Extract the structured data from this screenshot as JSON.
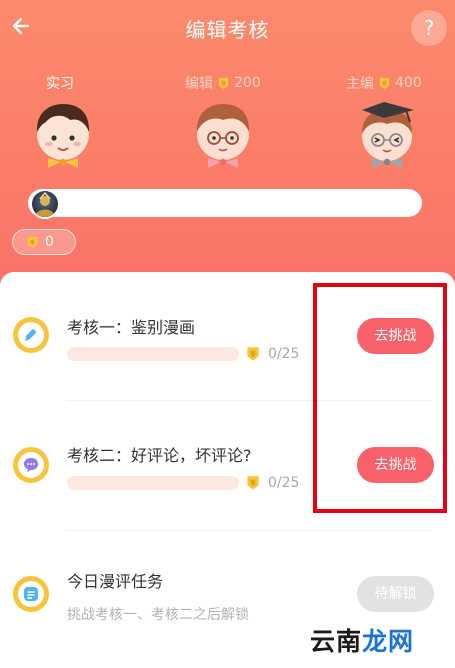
{
  "header": {
    "title": "编辑考核",
    "help_label": "?"
  },
  "levels": [
    {
      "label": "实习",
      "coins": ""
    },
    {
      "label": "编辑",
      "coins": "200"
    },
    {
      "label": "主编",
      "coins": "400"
    }
  ],
  "progress": {
    "score": "0",
    "fill_fraction": 0
  },
  "tasks": [
    {
      "title": "考核一：鉴别漫画",
      "count": "0/25",
      "button": "去挑战",
      "progress_fraction": 0
    },
    {
      "title": "考核二：好评论，坏评论?",
      "count": "0/25",
      "button": "去挑战",
      "progress_fraction": 0
    },
    {
      "title": "今日漫评任务",
      "subtitle": "挑战考核一、考核二之后解锁",
      "button": "待解锁"
    }
  ],
  "watermark": {
    "part1": "云南",
    "part2": "龙网"
  },
  "colors": {
    "accent": "#f8606a",
    "header_top": "#fb8a6c",
    "coin": "#f9c33c"
  }
}
